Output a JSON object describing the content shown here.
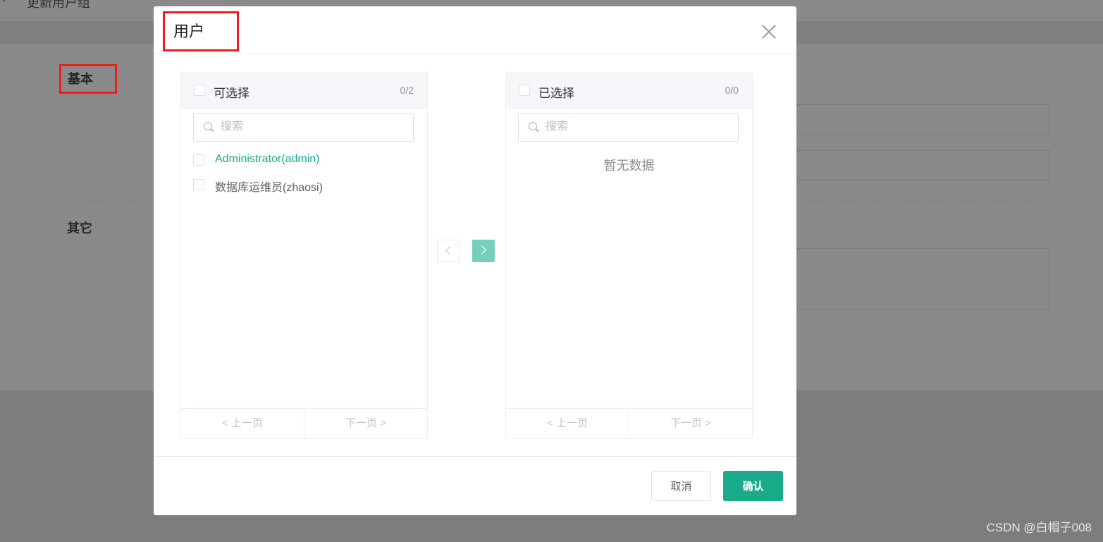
{
  "background_page": {
    "back_icon": "chevron-left-icon",
    "title": "更新用户组",
    "section_basic": "基本",
    "section_other": "其它"
  },
  "modal": {
    "title": "用户",
    "close_icon": "close-icon",
    "left_panel": {
      "title": "可选择",
      "count": "0/2",
      "search_placeholder": "搜索",
      "items": [
        {
          "label": "Administrator(admin)",
          "highlighted": true
        },
        {
          "label": "数据库运维员(zhaosi)",
          "highlighted": false
        }
      ],
      "prev_page": "< 上一页",
      "next_page": "下一页 >"
    },
    "right_panel": {
      "title": "已选择",
      "count": "0/0",
      "search_placeholder": "搜索",
      "empty_text": "暂无数据",
      "prev_page": "< 上一页",
      "next_page": "下一页 >"
    },
    "move_left_icon": "chevron-left-icon",
    "move_right_icon": "chevron-right-icon",
    "cancel_label": "取消",
    "confirm_label": "确认"
  },
  "watermark": "CSDN @白帽子008",
  "colors": {
    "accent": "#1aab8a",
    "highlight_box": "#ef1d1d",
    "overlay": "#8a8a8a"
  }
}
